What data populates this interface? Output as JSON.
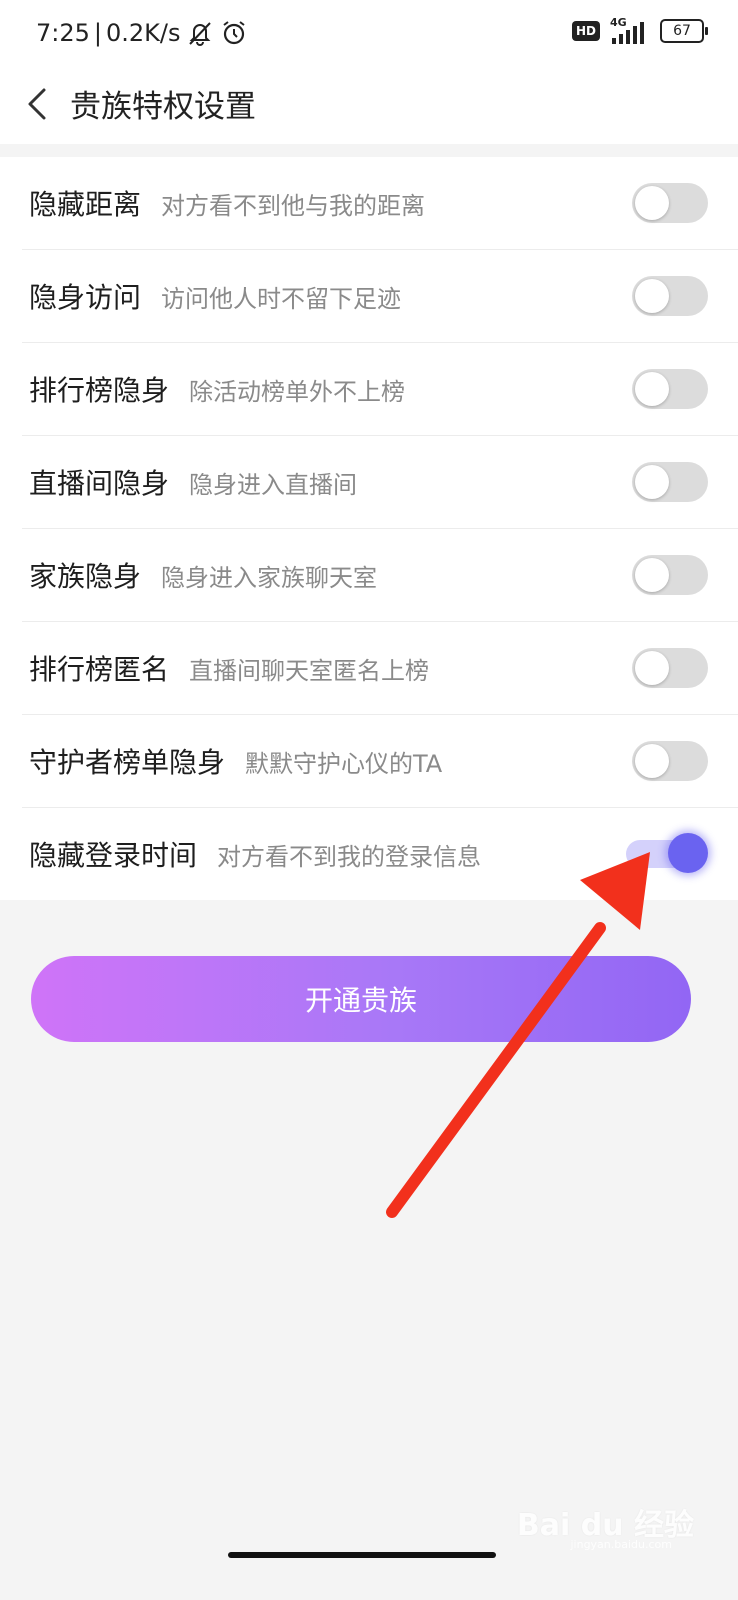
{
  "status_bar": {
    "time": "7:25",
    "separator": "|",
    "speed": "0.2K/s",
    "icons": [
      "mute-icon",
      "alarm-icon"
    ],
    "hd_badge": "HD",
    "network": "4G",
    "battery": "67"
  },
  "header": {
    "back_icon": "chevron-left-icon",
    "title": "贵族特权设置"
  },
  "settings": [
    {
      "label": "隐藏距离",
      "desc": "对方看不到他与我的距离",
      "enabled": false
    },
    {
      "label": "隐身访问",
      "desc": "访问他人时不留下足迹",
      "enabled": false
    },
    {
      "label": "排行榜隐身",
      "desc": "除活动榜单外不上榜",
      "enabled": false
    },
    {
      "label": "直播间隐身",
      "desc": "隐身进入直播间",
      "enabled": false
    },
    {
      "label": "家族隐身",
      "desc": "隐身进入家族聊天室",
      "enabled": false
    },
    {
      "label": "排行榜匿名",
      "desc": "直播间聊天室匿名上榜",
      "enabled": false
    },
    {
      "label": "守护者榜单隐身",
      "desc": "默默守护心仪的TA",
      "enabled": false
    },
    {
      "label": "隐藏登录时间",
      "desc": "对方看不到我的登录信息",
      "enabled": true
    }
  ],
  "cta": {
    "label": "开通贵族"
  },
  "annotation": {
    "icon": "red-arrow-icon",
    "color": "#f2301c"
  },
  "watermark": {
    "brand": "Bai du 经验",
    "url": "jingyan.baidu.com"
  },
  "colors": {
    "accent": "#6a63f0",
    "cta_start": "#cf74f8",
    "cta_end": "#9266f4"
  }
}
